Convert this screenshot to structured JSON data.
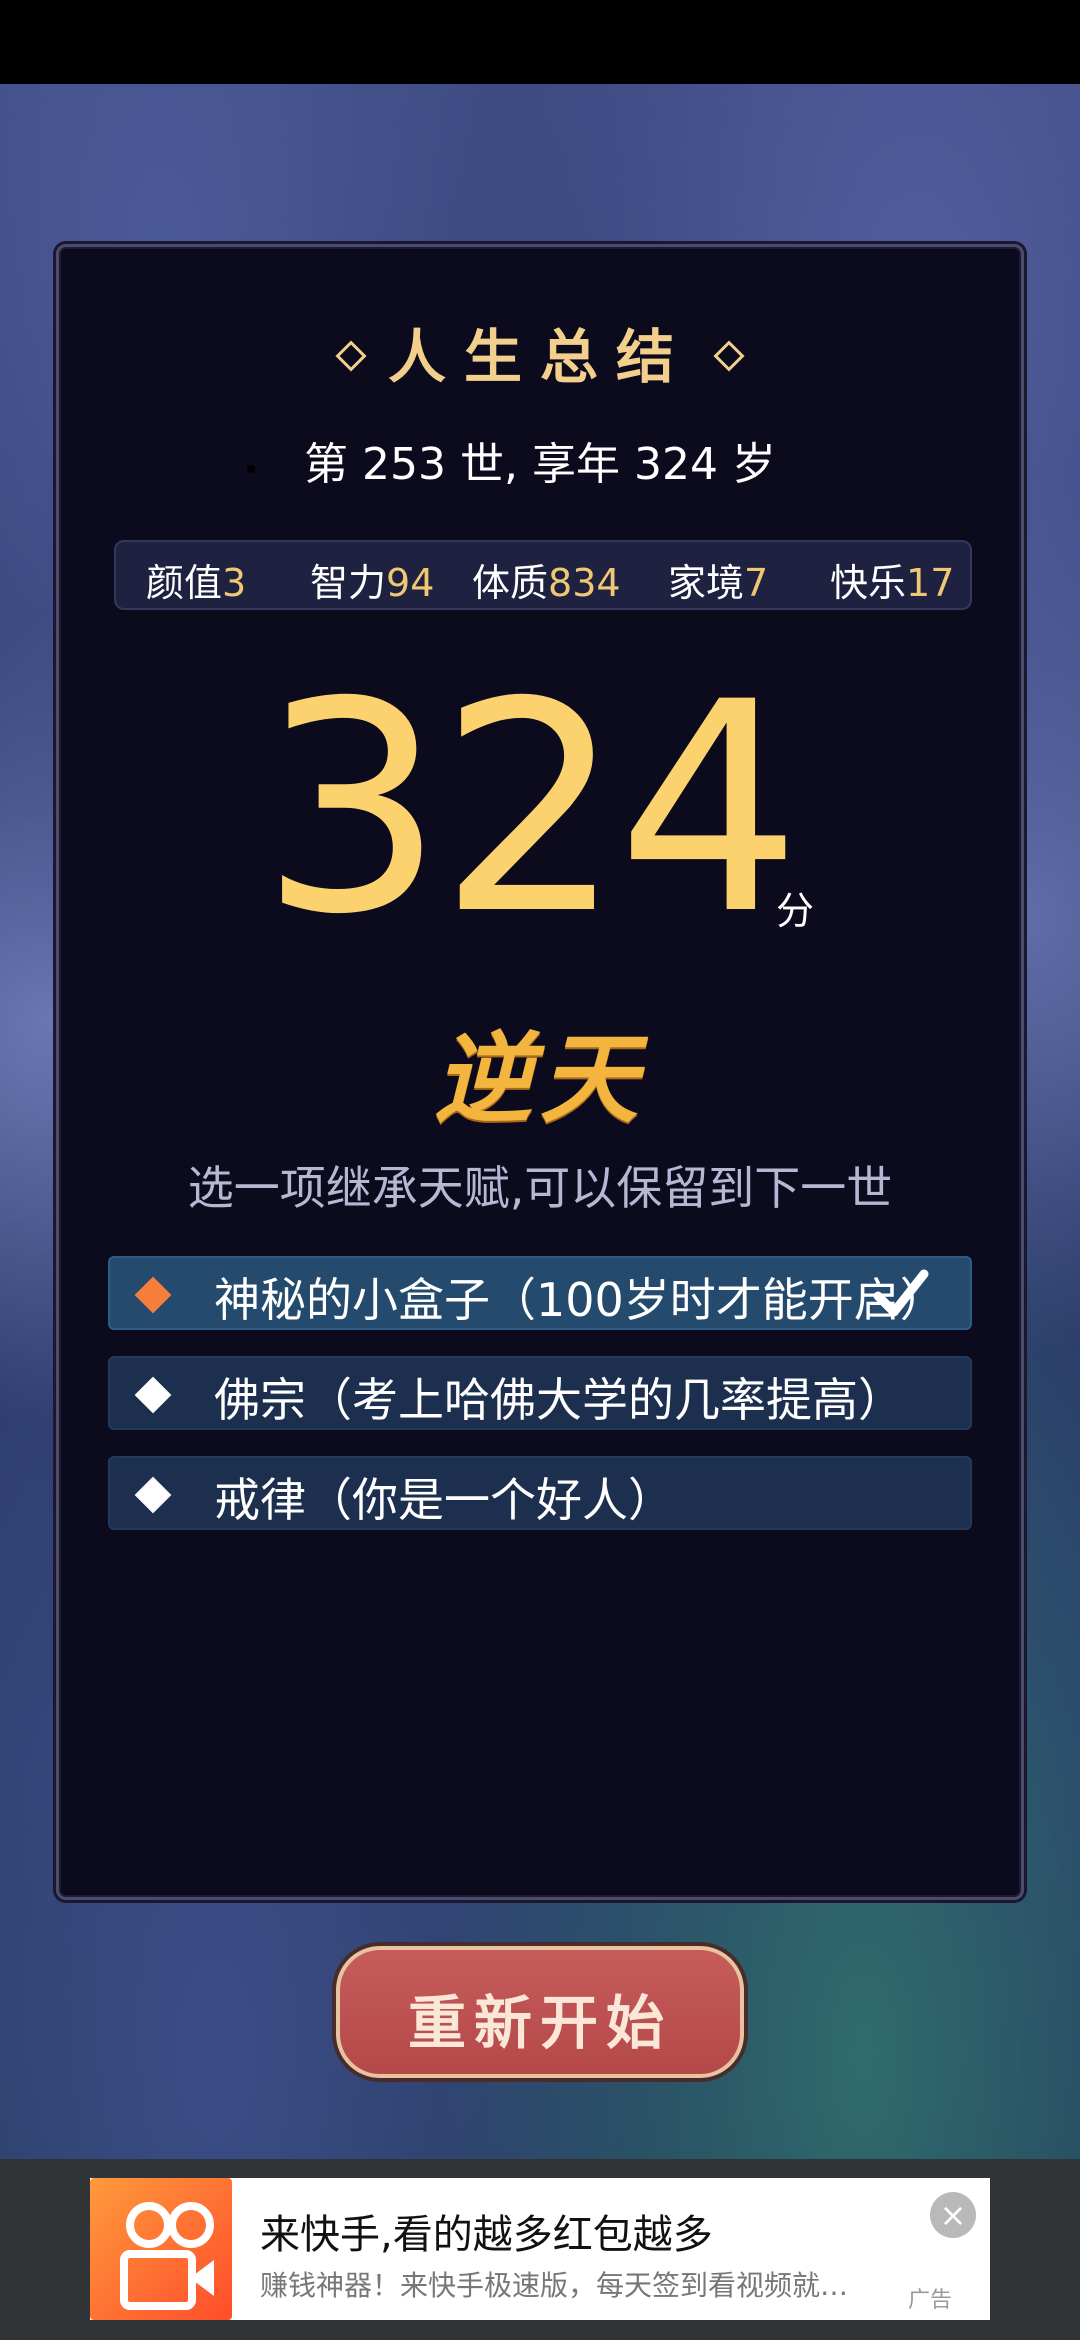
{
  "summary": {
    "title": "人生总结",
    "life_info": "第 253 世, 享年 324 岁",
    "attributes": [
      {
        "label": "颜值",
        "value": "3"
      },
      {
        "label": "智力",
        "value": "94"
      },
      {
        "label": "体质",
        "value": "834"
      },
      {
        "label": "家境",
        "value": "7"
      },
      {
        "label": "快乐",
        "value": "17"
      }
    ],
    "score": "324",
    "score_unit": "分",
    "rank": "逆天",
    "inherit_hint": "选一项继承天赋,可以保留到下一世",
    "talents": [
      {
        "label": "神秘的小盒子（100岁时才能开启）",
        "selected": true
      },
      {
        "label": "佛宗（考上哈佛大学的几率提高）",
        "selected": false
      },
      {
        "label": "戒律（你是一个好人）",
        "selected": false
      }
    ],
    "restart_label": "重新开始"
  },
  "ad": {
    "title": "来快手,看的越多红包越多",
    "description": "赚钱神器！来快手极速版，每天签到看视频就…",
    "tag": "广告",
    "close_icon": "close-icon",
    "logo_icon": "kuaishou-logo-icon"
  },
  "colors": {
    "accent_gold": "#fbd26d",
    "selected_marker": "#f47e3a",
    "restart_button": "#b54848"
  }
}
